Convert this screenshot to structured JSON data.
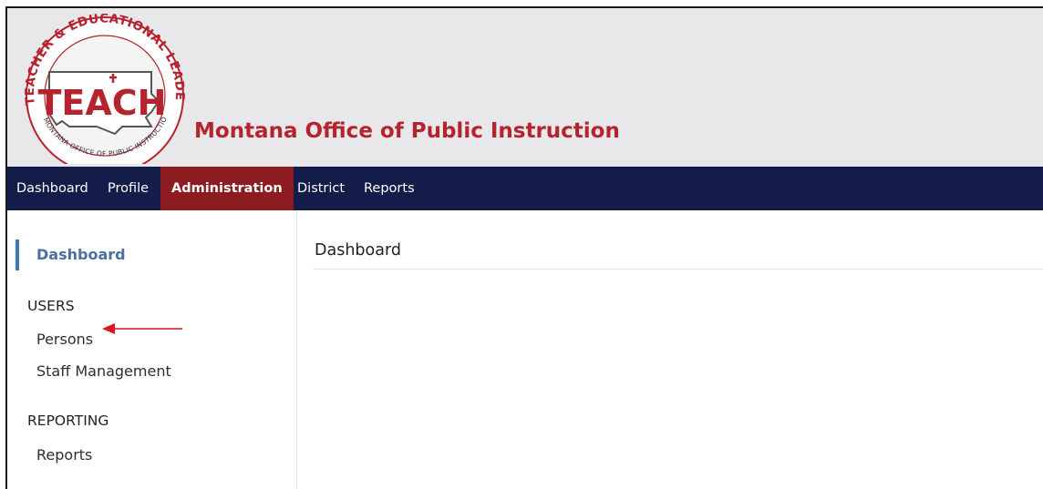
{
  "header": {
    "site_title": "Montana Office of Public Instruction",
    "logo": {
      "ring_text_top": "TEACHER & EDUCATIONAL LEADERS",
      "ring_text_bottom": "MONTANA OFFICE OF PUBLIC INSTRUCTION",
      "center_text": "TEACH"
    }
  },
  "nav": {
    "items": [
      {
        "label": "Dashboard",
        "active": false
      },
      {
        "label": "Profile",
        "active": false
      },
      {
        "label": "Administration",
        "active": true
      },
      {
        "label": "District",
        "active": false
      },
      {
        "label": "Reports",
        "active": false
      }
    ]
  },
  "sidebar": {
    "dashboard": "Dashboard",
    "sections": [
      {
        "heading": "USERS",
        "links": [
          "Persons",
          "Staff Management"
        ]
      },
      {
        "heading": "REPORTING",
        "links": [
          "Reports"
        ]
      }
    ]
  },
  "main": {
    "title": "Dashboard"
  },
  "colors": {
    "brand_red": "#b5232f",
    "nav_bg": "#141c4a",
    "nav_active_bg": "#8c1b22",
    "side_active": "#3d7ab8",
    "annotation_arrow": "#e0141e"
  }
}
